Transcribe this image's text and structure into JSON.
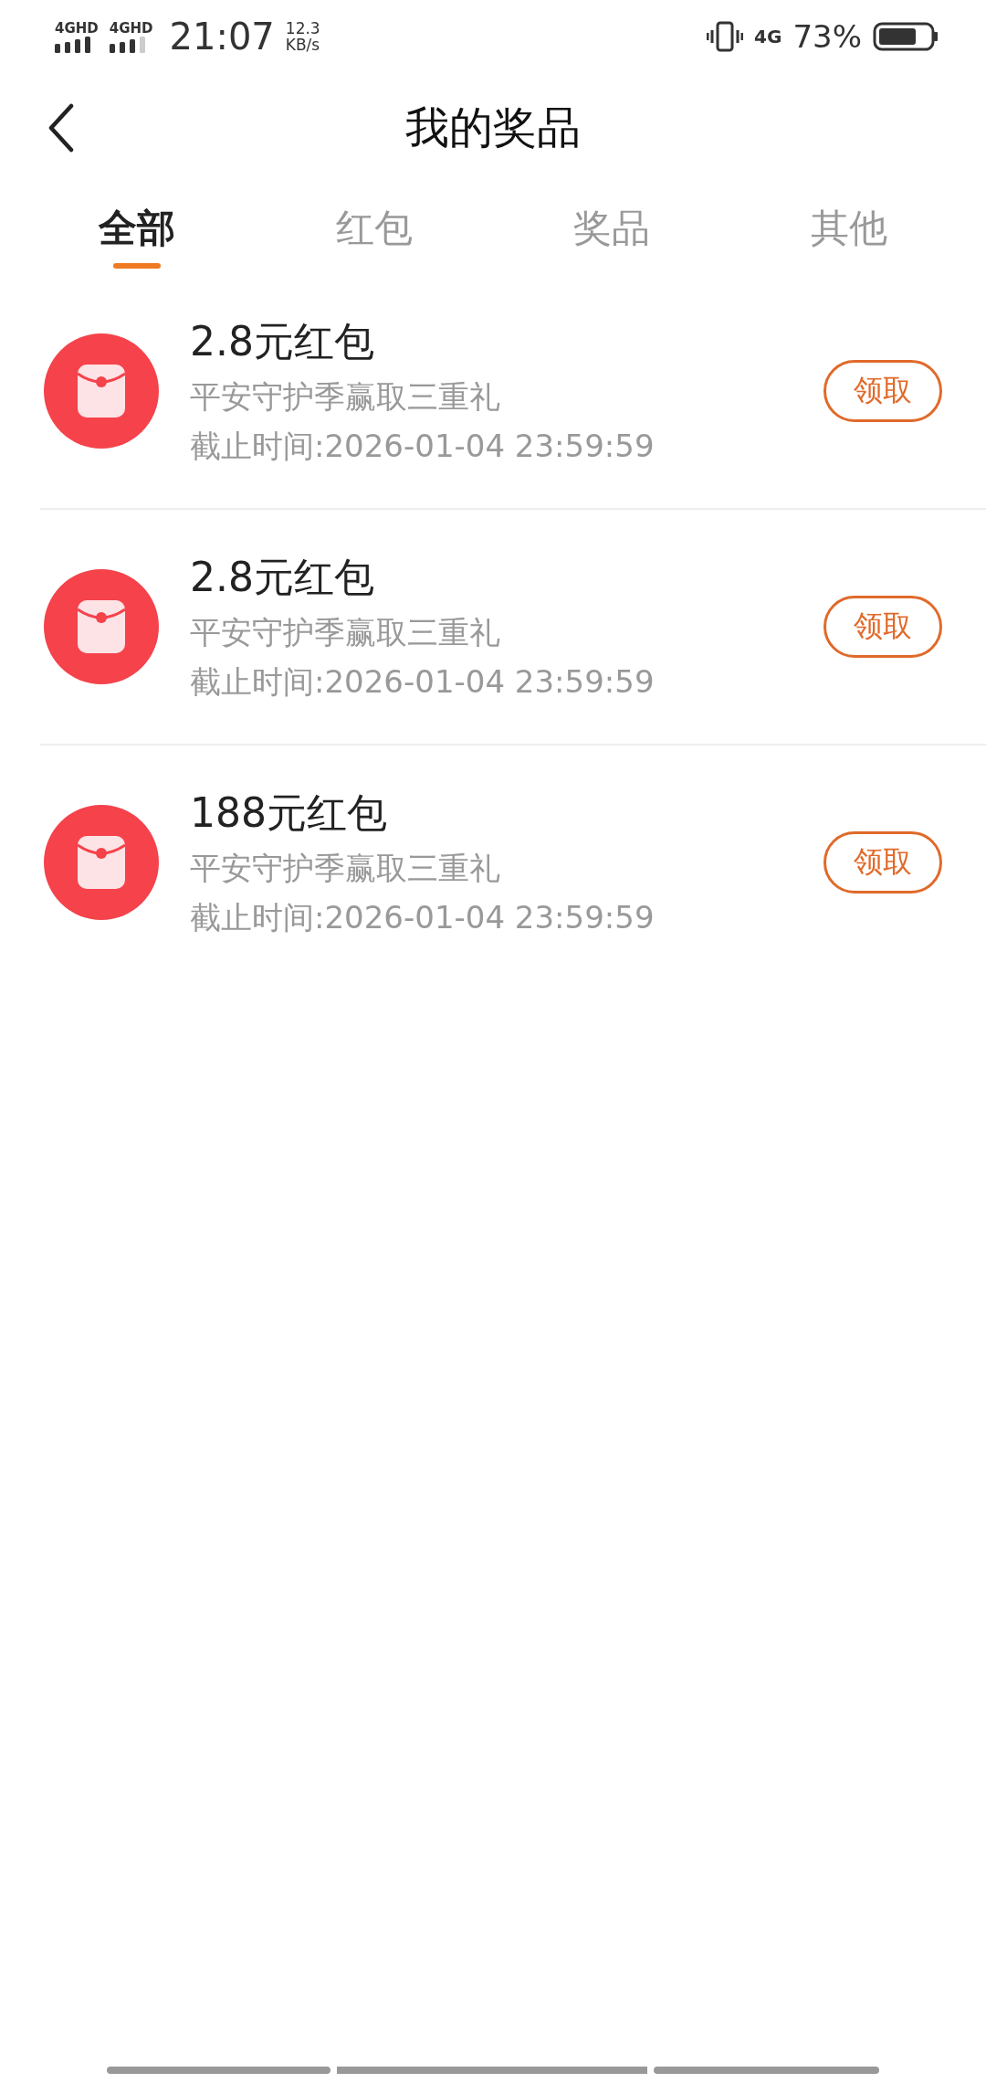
{
  "status_bar": {
    "sim_labels": [
      "4GHD",
      "4GHD"
    ],
    "time": "21:07",
    "speed_value": "12.3",
    "speed_unit": "KB/s",
    "network": "4G",
    "battery": "73%"
  },
  "header": {
    "title": "我的奖品"
  },
  "tabs": [
    {
      "label": "全部",
      "selected": true
    },
    {
      "label": "红包",
      "selected": false
    },
    {
      "label": "奖品",
      "selected": false
    },
    {
      "label": "其他",
      "selected": false
    }
  ],
  "prizes": [
    {
      "title": "2.8元红包",
      "subtitle": "平安守护季赢取三重礼",
      "deadline": "截止时间:2026-01-04 23:59:59",
      "action": "领取"
    },
    {
      "title": "2.8元红包",
      "subtitle": "平安守护季赢取三重礼",
      "deadline": "截止时间:2026-01-04 23:59:59",
      "action": "领取"
    },
    {
      "title": "188元红包",
      "subtitle": "平安守护季赢取三重礼",
      "deadline": "截止时间:2026-01-04 23:59:59",
      "action": "领取"
    }
  ]
}
